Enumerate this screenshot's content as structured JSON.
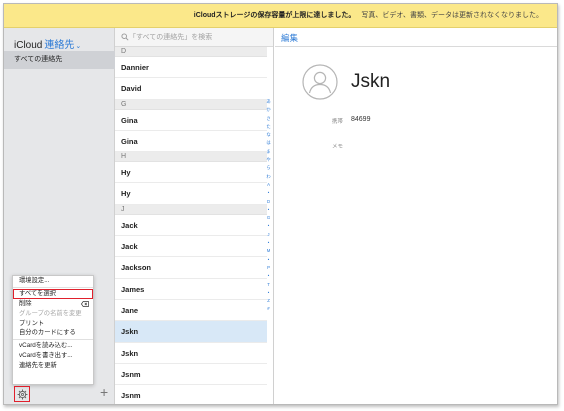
{
  "banner": {
    "message": "iCloudストレージの保存容量が上限に達しました。",
    "extra": "写真、ビデオ、書類、データは更新されなくなりました。"
  },
  "sidebar": {
    "brand": "iCloud",
    "section": "連絡先",
    "group": "すべての連絡先"
  },
  "menu": {
    "items": [
      {
        "label": "環境設定..."
      },
      {
        "label": "すべてを選択"
      },
      {
        "label": "削除"
      },
      {
        "label": "グループの名前を変更"
      },
      {
        "label": "プリント"
      },
      {
        "label": "自分のカードにする"
      },
      {
        "label": "vCardを読み込む..."
      },
      {
        "label": "vCardを書き出す..."
      },
      {
        "label": "連絡先を更新"
      }
    ]
  },
  "list": {
    "search_placeholder": "「すべての連絡先」を検索",
    "sections": [
      {
        "letter": "D",
        "contacts": [
          "Dannier",
          "David"
        ]
      },
      {
        "letter": "G",
        "contacts": [
          "Gina",
          "Gina"
        ]
      },
      {
        "letter": "H",
        "contacts": [
          "Hy",
          "Hy"
        ]
      },
      {
        "letter": "J",
        "contacts": [
          "Jack",
          "Jack",
          "Jackson",
          "James",
          "Jane",
          "Jskn",
          "Jskn",
          "Jsnm",
          "Jsnm"
        ]
      }
    ],
    "selected": "Jskn",
    "index_letters": [
      "あ",
      "か",
      "さ",
      "た",
      "な",
      "は",
      "ま",
      "や",
      "ら",
      "わ",
      "A",
      "•",
      "D",
      "•",
      "G",
      "•",
      "J",
      "•",
      "M",
      "•",
      "P",
      "•",
      "T",
      "•",
      "Z",
      "#"
    ]
  },
  "detail": {
    "edit_label": "編集",
    "name": "Jskn",
    "fields": [
      {
        "label": "携帯",
        "value": "84699"
      },
      {
        "label": "メモ",
        "value": ""
      }
    ]
  },
  "colors": {
    "accent": "#2d7bd6",
    "banner": "#fbe88a",
    "highlight": "#e0202c",
    "selected_row": "#d8e8f7"
  }
}
